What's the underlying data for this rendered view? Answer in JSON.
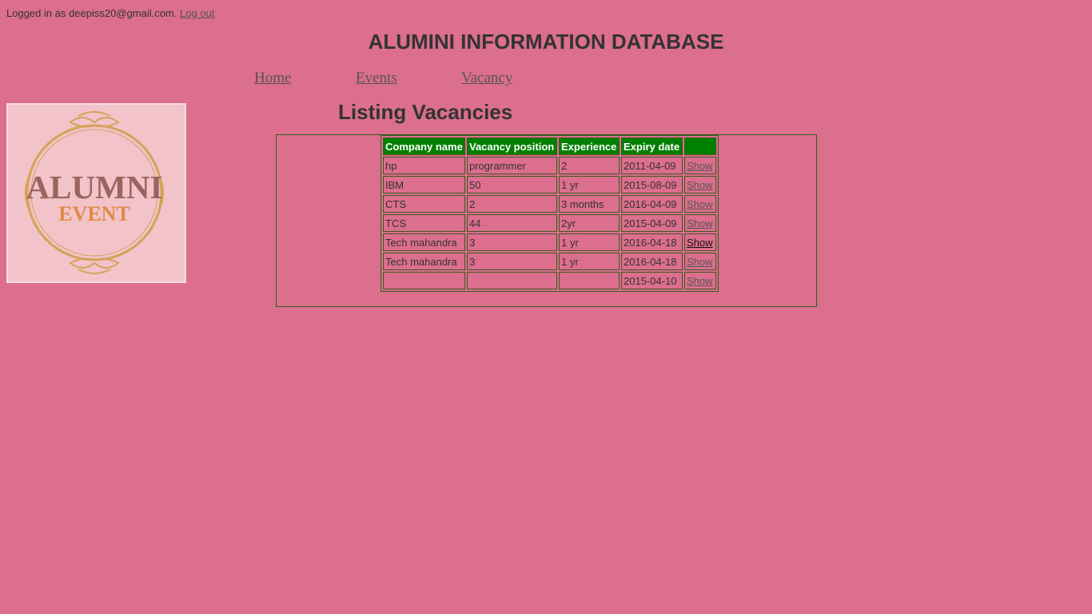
{
  "session": {
    "prefix": "Logged in as deepiss20@gmail.com.",
    "logout_label": "Log out"
  },
  "site": {
    "title": "ALUMINI INFORMATION DATABASE"
  },
  "nav": {
    "items": [
      {
        "label": "Home"
      },
      {
        "label": "Events"
      },
      {
        "label": "Vacancy"
      }
    ]
  },
  "logo": {
    "text_main": "ALUMNI",
    "text_sub": "EVENT"
  },
  "page": {
    "heading": "Listing Vacancies"
  },
  "table": {
    "headers": [
      "Company name",
      "Vacancy position",
      "Experience",
      "Expiry date",
      ""
    ],
    "rows": [
      {
        "company": "hp",
        "position": "programmer",
        "experience": "2",
        "expiry": "2011-04-09",
        "action": "Show"
      },
      {
        "company": "IBM",
        "position": "50",
        "experience": "1 yr",
        "expiry": "2015-08-09",
        "action": "Show"
      },
      {
        "company": "CTS",
        "position": "2",
        "experience": "3 months",
        "expiry": "2016-04-09",
        "action": "Show"
      },
      {
        "company": "TCS",
        "position": "44",
        "experience": "2yr",
        "expiry": "2015-04-09",
        "action": "Show"
      },
      {
        "company": "Tech mahandra",
        "position": "3",
        "experience": "1 yr",
        "expiry": "2016-04-18",
        "action": "Show"
      },
      {
        "company": "Tech mahandra",
        "position": "3",
        "experience": "1 yr",
        "expiry": "2016-04-18",
        "action": "Show"
      },
      {
        "company": "",
        "position": "",
        "experience": "",
        "expiry": "2015-04-10",
        "action": "Show"
      }
    ]
  },
  "colors": {
    "background": "#dc6e8e",
    "header_green": "#008000",
    "logo_bg": "#f2c3c9",
    "logo_gold": "#d4a35a",
    "logo_brown": "#9b6460",
    "logo_orange": "#e08a45"
  }
}
